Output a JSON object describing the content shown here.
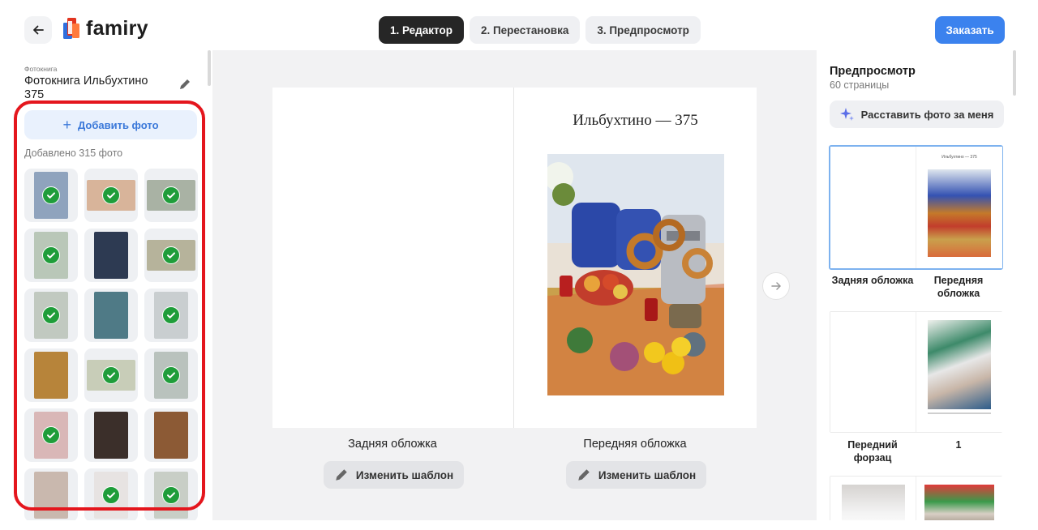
{
  "header": {
    "back_icon": "arrow-left-icon",
    "logo_text": "famiry",
    "steps": [
      "1. Редактор",
      "2. Перестановка",
      "3. Предпросмотр"
    ],
    "active_step": 0,
    "order_label": "Заказать"
  },
  "sidebar": {
    "book_label": "Фотокнига",
    "book_title": "Фотокнига Ильбухтино 375",
    "add_photo_label": "Добавить фото",
    "added_count": "Добавлено 315 фото",
    "photos": [
      {
        "orient": "p",
        "color": "#8fa3bd",
        "checked": true
      },
      {
        "orient": "l",
        "color": "#d8b49a",
        "checked": true
      },
      {
        "orient": "l",
        "color": "#a9b2a4",
        "checked": true
      },
      {
        "orient": "p",
        "color": "#b9c7b8",
        "checked": true
      },
      {
        "orient": "p",
        "color": "#2d3a52",
        "checked": false
      },
      {
        "orient": "l",
        "color": "#b6b39b",
        "checked": true
      },
      {
        "orient": "p",
        "color": "#c1c9c0",
        "checked": true
      },
      {
        "orient": "p",
        "color": "#4f7a86",
        "checked": false
      },
      {
        "orient": "p",
        "color": "#c9ced0",
        "checked": true
      },
      {
        "orient": "p",
        "color": "#b7843a",
        "checked": false
      },
      {
        "orient": "l",
        "color": "#c8cdb8",
        "checked": true
      },
      {
        "orient": "p",
        "color": "#b9c2bd",
        "checked": true
      },
      {
        "orient": "p",
        "color": "#d9b7b7",
        "checked": true
      },
      {
        "orient": "p",
        "color": "#3b2f2a",
        "checked": false
      },
      {
        "orient": "p",
        "color": "#8c5a35",
        "checked": false
      },
      {
        "orient": "p",
        "color": "#c9b8ae",
        "checked": false
      },
      {
        "orient": "p",
        "color": "#e7e3e2",
        "checked": true
      },
      {
        "orient": "p",
        "color": "#c8cec6",
        "checked": true
      }
    ]
  },
  "editor": {
    "front_title": "Ильбухтино — 375",
    "back_caption": "Задняя обложка",
    "front_caption": "Передняя обложка",
    "change_template_label": "Изменить шаблон",
    "next_icon": "arrow-right-icon"
  },
  "preview": {
    "title": "Предпросмотр",
    "subtitle": "60 страницы",
    "auto_label": "Расставить фото за меня",
    "spreads": [
      {
        "left_label": "Задняя обложка",
        "right_label": "Передняя обложка",
        "mini_title": "Ильбухтино — 375",
        "selected": true
      },
      {
        "left_label": "Передний форзац",
        "right_label": "1",
        "selected": false
      },
      {
        "left_label": "",
        "right_label": "",
        "selected": false
      }
    ]
  },
  "colors": {
    "accent": "#3b82ee",
    "active_step": "#262626",
    "check": "#1f9d3a",
    "highlight": "#e4161d",
    "logo_red": "#e2341f",
    "logo_blue": "#2f6fde"
  }
}
